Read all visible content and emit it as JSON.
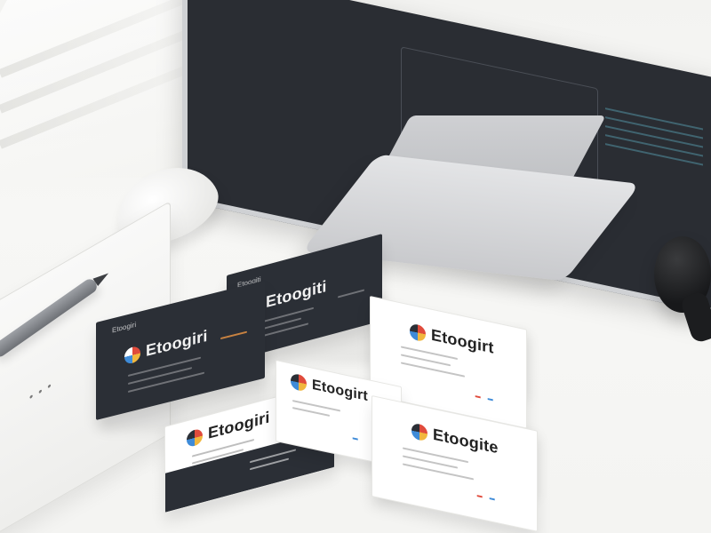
{
  "cards": {
    "top_dark": {
      "brand": "Etoogiti",
      "small_label": "Etoogiti"
    },
    "left_dark": {
      "brand": "Etoogiri",
      "small_label": "Etoogiri"
    },
    "bottom_left": {
      "brand": "Etoogiri"
    },
    "middle_white": {
      "brand": "Etoogirt"
    },
    "small_white": {
      "brand": "Etoogirt"
    },
    "right_white": {
      "brand": "Etoogite"
    }
  },
  "colors": {
    "card_dark": "#2b2f36",
    "logo_red": "#e04b3c",
    "logo_yellow": "#f1b73e",
    "logo_blue": "#3e8bd8"
  }
}
